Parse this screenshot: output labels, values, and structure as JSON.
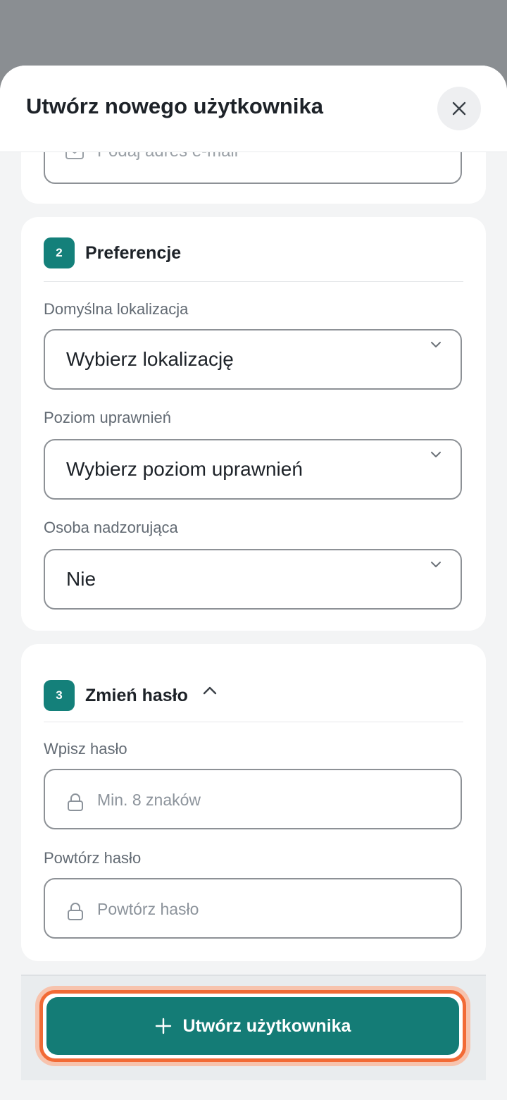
{
  "header": {
    "title": "Utwórz nowego użytkownika",
    "close_icon": "close-icon"
  },
  "account": {
    "email_placeholder": "Podaj adres e-mail",
    "email_icon": "envelope-icon"
  },
  "preferences": {
    "step": "2",
    "title": "Preferencje",
    "location": {
      "label": "Domyślna lokalizacja",
      "value": "Wybierz lokalizację"
    },
    "permission": {
      "label": "Poziom uprawnień",
      "value": "Wybierz poziom uprawnień"
    },
    "supervisor": {
      "label": "Osoba nadzorująca",
      "value": "Nie"
    }
  },
  "password": {
    "step": "3",
    "title": "Zmień hasło",
    "enter": {
      "label": "Wpisz hasło",
      "placeholder": "Min. 8 znaków"
    },
    "repeat": {
      "label": "Powtórz hasło",
      "placeholder": "Powtórz hasło"
    }
  },
  "footer": {
    "create_label": "Utwórz użytkownika"
  },
  "colors": {
    "accent": "#147c76",
    "highlight": "#f26a35",
    "muted_text": "#626a73"
  }
}
